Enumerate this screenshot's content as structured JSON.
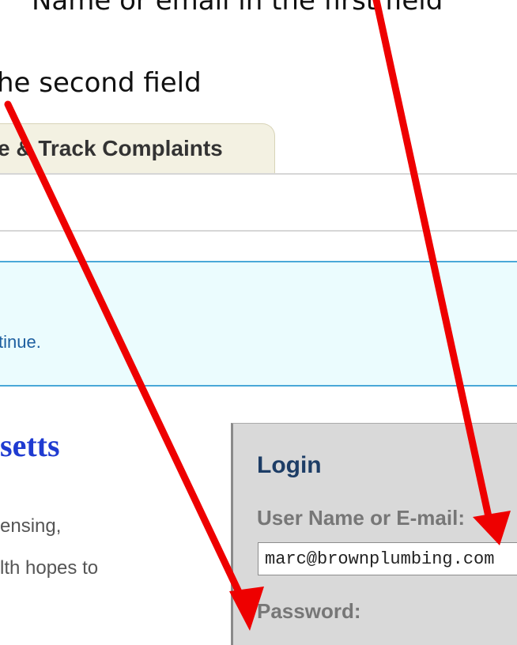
{
  "instructions": {
    "line1": "Name or email in the first field",
    "line2": "he second field"
  },
  "tabs": {
    "complaints_label": "e & Track Complaints"
  },
  "banner": {
    "text": "tinue."
  },
  "main": {
    "heading": "setts",
    "lines": [
      "ensing,",
      "lth hopes to"
    ]
  },
  "login": {
    "title": "Login",
    "username_label": "User Name or E-mail:",
    "username_value": "marc@brownplumbing.com",
    "password_label": "Password:"
  },
  "colors": {
    "annotation_arrow": "#ee0000",
    "banner_bg": "#ebfcfe",
    "heading": "#1f3bd1",
    "login_title": "#1d3d66"
  }
}
